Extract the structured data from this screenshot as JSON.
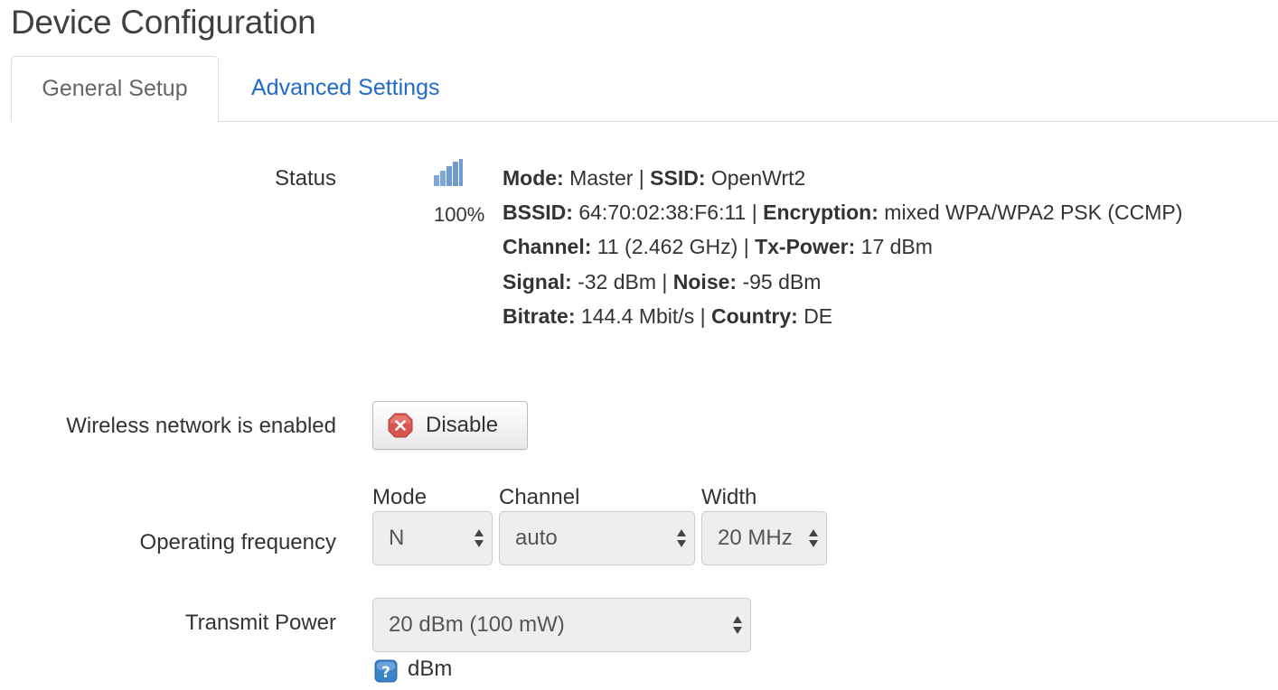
{
  "page": {
    "title": "Device Configuration"
  },
  "tabs": [
    {
      "label": "General Setup",
      "active": true
    },
    {
      "label": "Advanced Settings",
      "active": false
    }
  ],
  "status": {
    "label": "Status",
    "signal_icon": "signal-bars-icon",
    "signal_percent": "100%",
    "lines": [
      [
        {
          "key": "Mode:",
          "value": "Master"
        },
        {
          "key": "SSID:",
          "value": "OpenWrt2"
        }
      ],
      [
        {
          "key": "BSSID:",
          "value": "64:70:02:38:F6:11"
        },
        {
          "key": "Encryption:",
          "value": "mixed WPA/WPA2 PSK (CCMP)"
        }
      ],
      [
        {
          "key": "Channel:",
          "value": "11 (2.462 GHz)"
        },
        {
          "key": "Tx-Power:",
          "value": "17 dBm"
        }
      ],
      [
        {
          "key": "Signal:",
          "value": "-32 dBm"
        },
        {
          "key": "Noise:",
          "value": "-95 dBm"
        }
      ],
      [
        {
          "key": "Bitrate:",
          "value": "144.4 Mbit/s"
        },
        {
          "key": "Country:",
          "value": "DE"
        }
      ]
    ]
  },
  "wireless": {
    "label": "Wireless network is enabled",
    "button_label": "Disable",
    "button_icon": "stop-icon"
  },
  "frequency": {
    "label": "Operating frequency",
    "mode_label": "Mode",
    "mode_value": "N",
    "channel_label": "Channel",
    "channel_value": "auto",
    "width_label": "Width",
    "width_value": "20 MHz"
  },
  "txpower": {
    "label": "Transmit Power",
    "value": "20 dBm (100 mW)",
    "help_icon": "help-icon",
    "unit": "dBm"
  },
  "colors": {
    "link": "#1f6bc9",
    "signal": "#6f9bd1",
    "stop": "#d9534f",
    "help": "#3b83c8"
  }
}
